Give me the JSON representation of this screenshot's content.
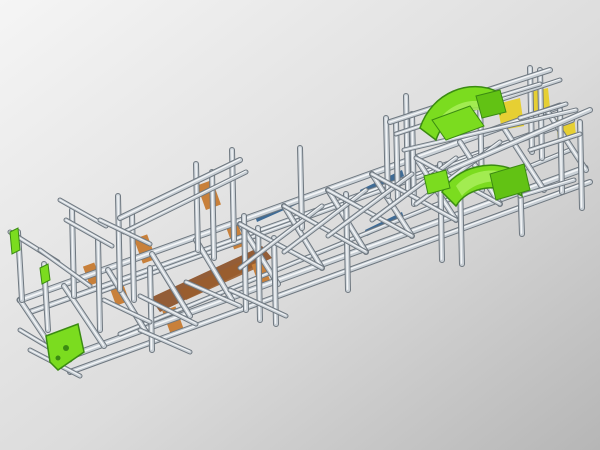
{
  "scene": {
    "subject": "bus-chassis-space-frame-cad-render",
    "view": "isometric"
  },
  "colors": {
    "background_light": "#f4f4f4",
    "background_dark": "#b9b9b9",
    "tube_metal": "#c9d0d6",
    "tube_metal_dark": "#6f7880",
    "tube_highlight": "#f3f5f7",
    "blue_member": "#3f6b95",
    "orange_bracket": "#c8803a",
    "brown_floor": "#8c5128",
    "green_part": "#7bdc1f",
    "green_part_dark": "#3b8b12",
    "yellow_bracket": "#e6cf33"
  }
}
